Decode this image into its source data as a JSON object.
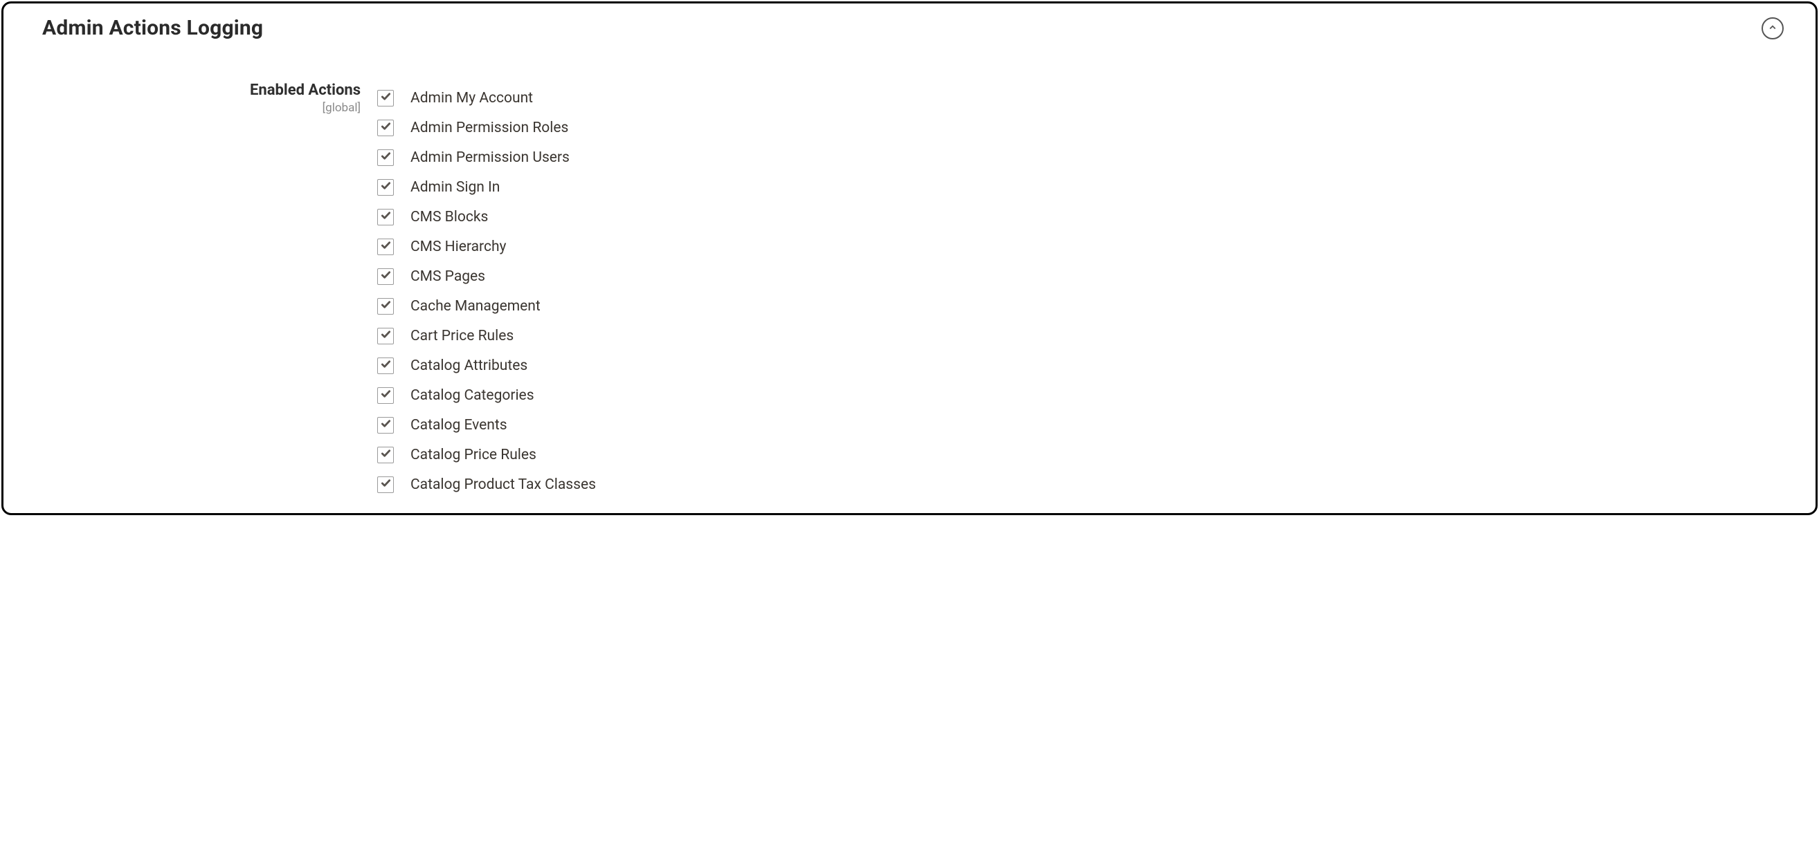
{
  "section": {
    "title": "Admin Actions Logging",
    "field_label": "Enabled Actions",
    "field_scope": "[global]",
    "options": [
      {
        "label": "Admin My Account",
        "checked": true
      },
      {
        "label": "Admin Permission Roles",
        "checked": true
      },
      {
        "label": "Admin Permission Users",
        "checked": true
      },
      {
        "label": "Admin Sign In",
        "checked": true
      },
      {
        "label": "CMS Blocks",
        "checked": true
      },
      {
        "label": "CMS Hierarchy",
        "checked": true
      },
      {
        "label": "CMS Pages",
        "checked": true
      },
      {
        "label": "Cache Management",
        "checked": true
      },
      {
        "label": "Cart Price Rules",
        "checked": true
      },
      {
        "label": "Catalog Attributes",
        "checked": true
      },
      {
        "label": "Catalog Categories",
        "checked": true
      },
      {
        "label": "Catalog Events",
        "checked": true
      },
      {
        "label": "Catalog Price Rules",
        "checked": true
      },
      {
        "label": "Catalog Product Tax Classes",
        "checked": true
      }
    ]
  }
}
